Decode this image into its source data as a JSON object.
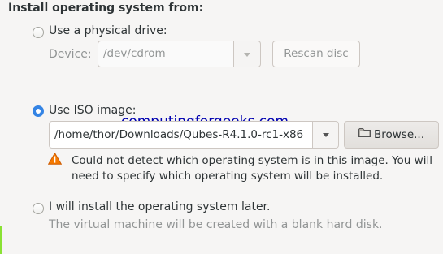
{
  "heading": "Install operating system from:",
  "physical": {
    "label": "Use a physical drive:",
    "device_label": "Device:",
    "device_value": "/dev/cdrom",
    "rescan_label": "Rescan disc"
  },
  "iso": {
    "label": "Use ISO image:",
    "path_value": "/home/thor/Downloads/Qubes-R4.1.0-rc1-x86",
    "browse_label": "Browse...",
    "warning_text": "Could not detect which operating system is in this image. You will need to specify which operating system will be installed."
  },
  "watermark": "computingforgeeks.com",
  "later": {
    "label": "I will install the operating system later.",
    "sub_text": "The virtual machine will be created with a blank hard disk."
  },
  "colors": {
    "accent": "#3584e4",
    "warning": "#f57900",
    "watermark": "#0000b0"
  }
}
